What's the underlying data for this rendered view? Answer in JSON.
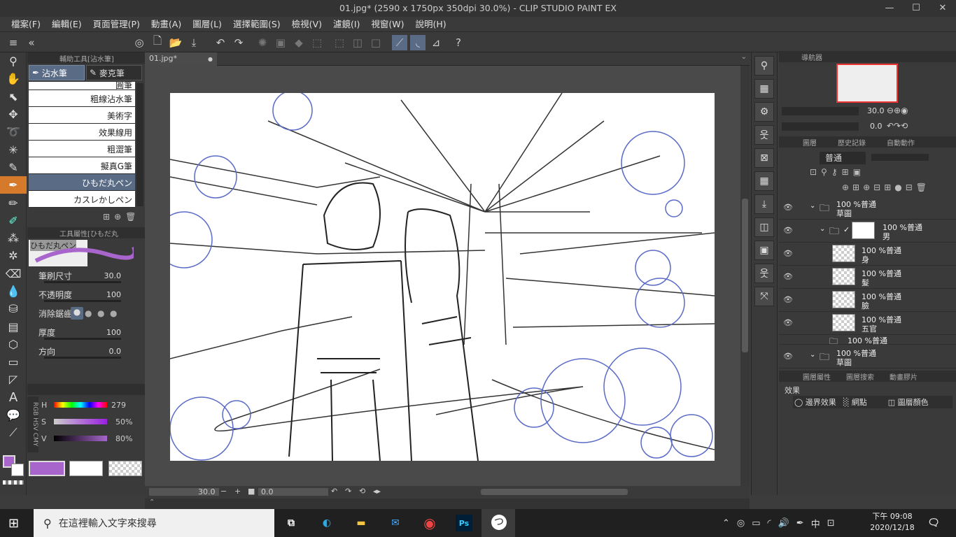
{
  "window": {
    "title": "01.jpg* (2590 x 1750px 350dpi 30.0%) - CLIP STUDIO PAINT EX",
    "min": "—",
    "max": "☐",
    "close": "✕"
  },
  "menu": [
    "檔案(F)",
    "編輯(E)",
    "頁面管理(P)",
    "動畫(A)",
    "圖層(L)",
    "選擇範圍(S)",
    "檢視(V)",
    "濾鏡(I)",
    "視窗(W)",
    "說明(H)"
  ],
  "subtool_panel": {
    "header": "輔助工具[沾水筆]",
    "tabs": [
      "沾水筆",
      "麥克筆"
    ],
    "brushes": [
      "圓筆",
      "粗線沾水筆",
      "美術字",
      "效果線用",
      "粗澀筆",
      "擬真G筆",
      "ひもだ丸ペン",
      "カスレかしペン"
    ],
    "selected_index": 6
  },
  "tool_property": {
    "header": "工具屬性[ひもだ丸",
    "preview_label": "ひもだ丸ペン",
    "brush_size_label": "筆刷尺寸",
    "brush_size_value": "30.0",
    "opacity_label": "不透明度",
    "opacity_value": "100",
    "aa_label": "消除鋸齒",
    "thickness_label": "厚度",
    "thickness_value": "100",
    "direction_label": "方向",
    "direction_value": "0.0"
  },
  "color_panel": {
    "mode_tabs": [
      "RGB",
      "HSV",
      "CMY"
    ],
    "h_label": "H",
    "h_value": "279",
    "s_label": "S",
    "s_value": "50%",
    "v_label": "V",
    "v_value": "80%",
    "main_color": "#a866cc",
    "sub_color": "#ffffff"
  },
  "document": {
    "tab": "01.jpg*"
  },
  "canvas_status": {
    "zoom": "30.0",
    "angle": "0.0"
  },
  "navigator": {
    "header": "導航器",
    "zoom": "30.0",
    "rotate": "0.0"
  },
  "layer_panel": {
    "tabs": [
      "圖層",
      "歷史記錄",
      "自動動作"
    ],
    "blend_mode": "普通",
    "layers": [
      {
        "opacity": "100 %普通",
        "name": "草圖",
        "indent": 0,
        "type": "folder"
      },
      {
        "opacity": "100 %普通",
        "name": "男",
        "indent": 1,
        "type": "folder"
      },
      {
        "opacity": "100 %普通",
        "name": "身",
        "indent": 2,
        "type": "raster"
      },
      {
        "opacity": "100 %普通",
        "name": "髮",
        "indent": 2,
        "type": "raster"
      },
      {
        "opacity": "100 %普通",
        "name": "臉",
        "indent": 2,
        "type": "raster"
      },
      {
        "opacity": "100 %普通",
        "name": "五官",
        "indent": 2,
        "type": "raster"
      },
      {
        "opacity": "100 %普通",
        "name": "",
        "indent": 1,
        "type": "folder"
      },
      {
        "opacity": "100 %普通",
        "name": "草圖",
        "indent": 0,
        "type": "folder"
      }
    ]
  },
  "layer_property": {
    "tabs": [
      "圖層屬性",
      "圖層搜索",
      "動畫膠片"
    ],
    "effect_label": "效果",
    "buttons": [
      "邊界效果",
      "網點",
      "圖層顏色"
    ]
  },
  "taskbar": {
    "search_placeholder": "在這裡輸入文字來搜尋",
    "time": "下午 09:08",
    "date": "2020/12/18",
    "ime": "中"
  }
}
